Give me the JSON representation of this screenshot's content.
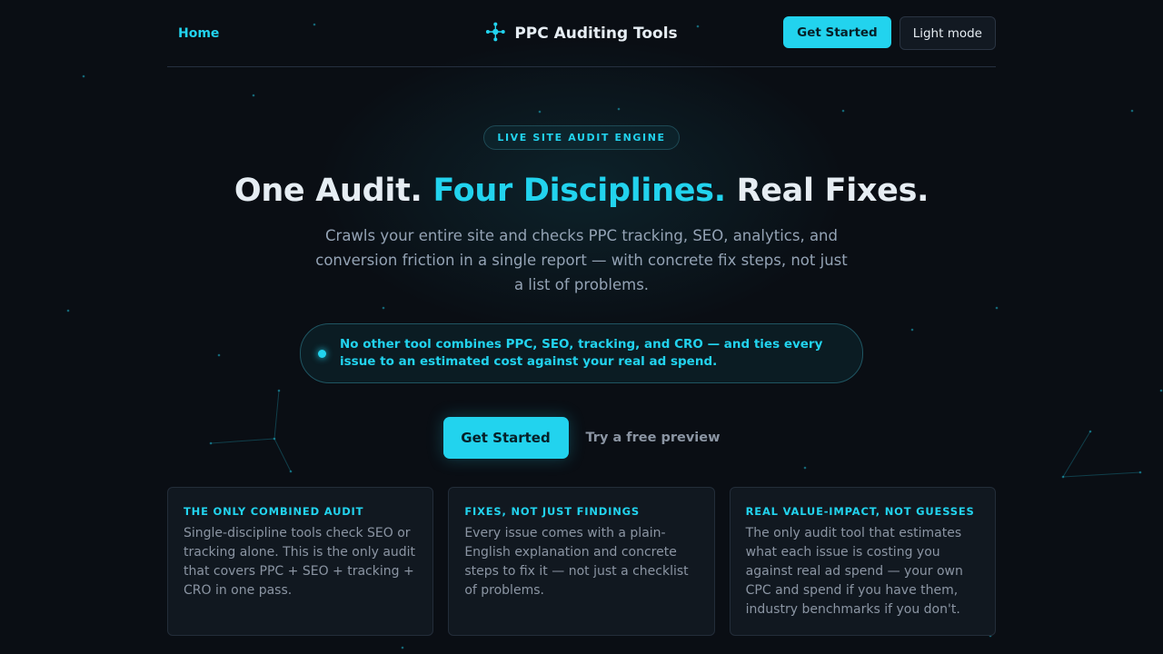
{
  "header": {
    "nav_home": "Home",
    "brand_name": "PPC Auditing Tools",
    "get_started_label": "Get Started",
    "theme_toggle_label": "Light mode"
  },
  "hero": {
    "eyebrow": "LIVE SITE AUDIT ENGINE",
    "title_part1": "One Audit.",
    "title_accent": "Four Disciplines.",
    "title_part2": "Real Fixes.",
    "description": "Crawls your entire site and checks PPC tracking, SEO, analytics, and conversion friction in a single report — with concrete fix steps, not just a list of problems.",
    "callout": "No other tool combines PPC, SEO, tracking, and CRO — and ties every issue to an estimated cost against your real ad spend.",
    "cta_label": "Get Started",
    "preview_link": "Try a free preview"
  },
  "features": [
    {
      "title": "THE ONLY COMBINED AUDIT",
      "body": "Single-discipline tools check SEO or tracking alone. This is the only audit that covers PPC + SEO + tracking + CRO in one pass."
    },
    {
      "title": "FIXES, NOT JUST FINDINGS",
      "body": "Every issue comes with a plain-English explanation and concrete steps to fix it — not just a checklist of problems."
    },
    {
      "title": "REAL VALUE-IMPACT, NOT GUESSES",
      "body": "The only audit tool that estimates what each issue is costing you against real ad spend — your own CPC and spend if you have them, industry benchmarks if you don't."
    }
  ],
  "icons": {
    "brand": "network-nodes-icon",
    "callout": "pulse-dot-icon"
  },
  "colors": {
    "accent": "#22d3ee",
    "background": "#0a0e14",
    "card": "#111820",
    "muted_text": "#8b95a3"
  }
}
